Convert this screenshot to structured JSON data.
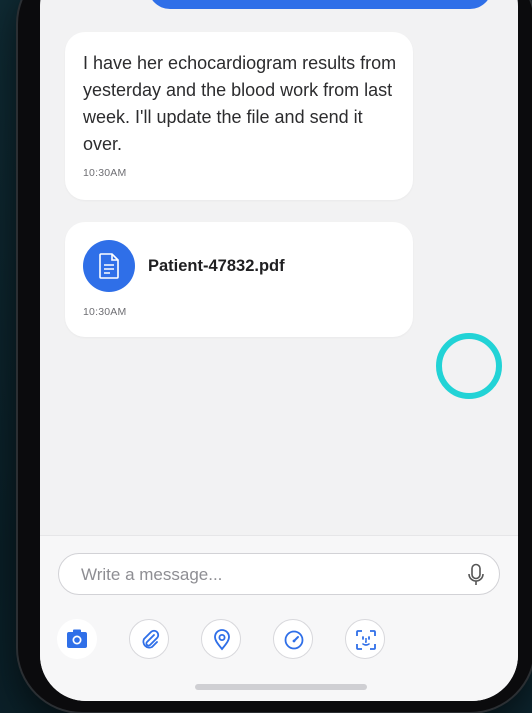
{
  "chat": {
    "messages": [
      {
        "type": "text",
        "text": "I have her echocardiogram results from yesterday and the blood work from last week. I'll update the file and send it over.",
        "time": "10:30AM"
      },
      {
        "type": "file",
        "file_name": "Patient-47832.pdf",
        "time": "10:30AM",
        "icon": "document-icon"
      }
    ],
    "typing_indicator_color": "#22d3d6",
    "outgoing_bubble_color": "#2f6fe8"
  },
  "composer": {
    "placeholder": "Write a message...",
    "value": "",
    "mic_icon": "microphone-icon",
    "tools": [
      {
        "name": "camera",
        "icon": "camera-icon"
      },
      {
        "name": "attachment",
        "icon": "paperclip-icon"
      },
      {
        "name": "location",
        "icon": "location-pin-icon"
      },
      {
        "name": "timer",
        "icon": "gauge-icon"
      },
      {
        "name": "face-scan",
        "icon": "face-scan-icon"
      }
    ]
  }
}
